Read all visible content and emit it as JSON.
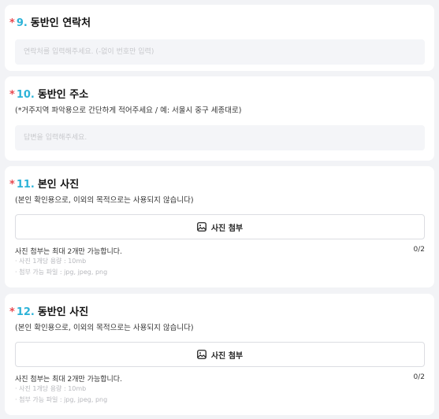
{
  "questions": [
    {
      "number": "9.",
      "title": "동반인 연락처",
      "placeholder": "연락처를 입력해주세요. (-없이 번호만 입력)"
    },
    {
      "number": "10.",
      "title": "동반인 주소",
      "hint": "(*거주지역 파악용으로 간단하게 적어주세요 / 예: 서울시 중구 세종대로)",
      "placeholder": "답변을 입력해주세요."
    },
    {
      "number": "11.",
      "title": "본인 사진",
      "hint": "(본인 확인용으로, 이외의 목적으로는 사용되지 않습니다)",
      "upload_label": "사진 첨부",
      "limit_text": "사진 첨부는 최대 2개만 가능합니다.",
      "count": "0/2",
      "notes": [
        "· 사진 1개당 용량 : 10mb",
        "· 첨부 가능 파일 : jpg, jpeg, png"
      ]
    },
    {
      "number": "12.",
      "title": "동반인 사진",
      "hint": "(본인 확인용으로, 이외의 목적으로는 사용되지 않습니다)",
      "upload_label": "사진 첨부",
      "limit_text": "사진 첨부는 최대 2개만 가능합니다.",
      "count": "0/2",
      "notes": [
        "· 사진 1개당 용량 : 10mb",
        "· 첨부 가능 파일 : jpg, jpeg, png"
      ]
    }
  ],
  "required_mark": "*",
  "icons": {
    "upload": "image-icon"
  },
  "colors": {
    "required": "#e8484f",
    "number": "#2db3d8",
    "background": "#f2f3f6"
  }
}
